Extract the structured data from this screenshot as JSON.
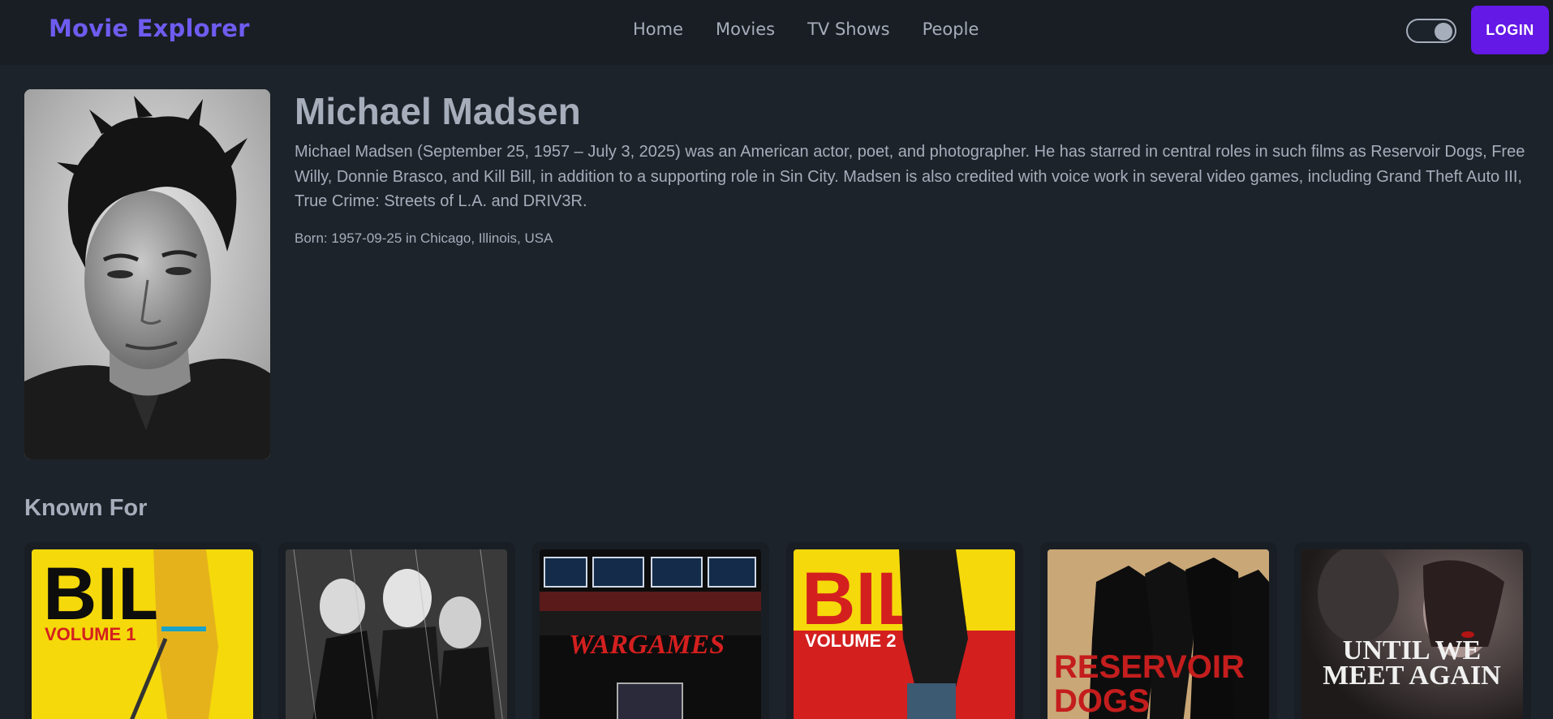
{
  "app": {
    "brand": "Movie Explorer"
  },
  "nav": {
    "links": [
      "Home",
      "Movies",
      "TV Shows",
      "People"
    ],
    "login_label": "LOGIN",
    "theme_toggle_on": true
  },
  "person": {
    "name": "Michael Madsen",
    "bio": "Michael Madsen (September 25, 1957 – July 3, 2025) was an American actor, poet, and photographer. He has starred in central roles in such films as Reservoir Dogs, Free Willy, Donnie Brasco, and Kill Bill, in addition to a supporting role in Sin City. Madsen is also credited with voice work in several video games, including Grand Theft Auto III, True Crime: Streets of L.A. and DRIV3R.",
    "born": "Born: 1957-09-25 in Chicago, Illinois, USA"
  },
  "known_for": {
    "title": "Known For",
    "posters": [
      {
        "text_big": "BILL",
        "text_small": "VOLUME 1",
        "bg": "#f5d90a"
      },
      {
        "text_big": "",
        "text_small": "",
        "bg": "#2a2a2a"
      },
      {
        "text_big": "WARGAMES",
        "text_small": "",
        "bg": "#0d0d0d"
      },
      {
        "text_big": "BILL",
        "text_small": "VOLUME 2",
        "bg": "#d41f1f"
      },
      {
        "text_big": "RESERVOIR",
        "text_small": "DOGS",
        "bg": "#c9a777"
      },
      {
        "text_big": "UNTIL WE",
        "text_small": "MEET AGAIN",
        "bg": "#2b2525"
      }
    ]
  }
}
